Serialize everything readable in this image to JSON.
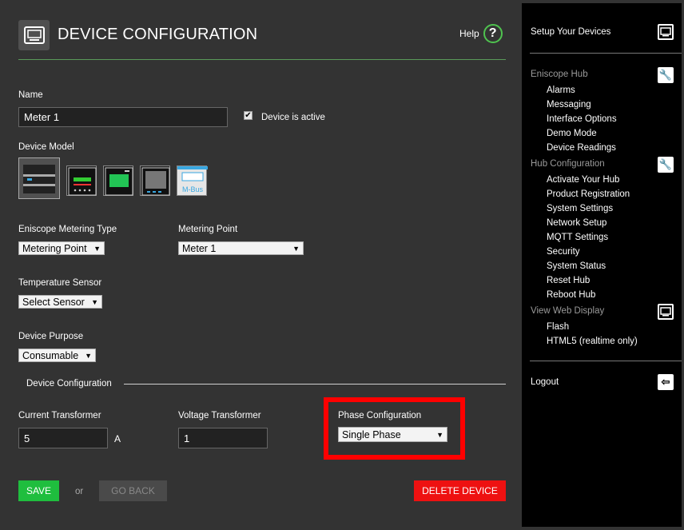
{
  "header": {
    "title": "DEVICE CONFIGURATION",
    "help_label": "Help",
    "help_icon": "question-circle-icon",
    "device_icon": "monitor-icon"
  },
  "form": {
    "name_label": "Name",
    "name_value": "Meter 1",
    "active_label": "Device is active",
    "active_checked": true,
    "model_label": "Device Model",
    "models": [
      {
        "icon": "din-rail-meter-icon",
        "selected": true
      },
      {
        "icon": "meter-display-red-icon",
        "selected": false
      },
      {
        "icon": "meter-display-green-icon",
        "selected": false
      },
      {
        "icon": "meter-display-grey-icon",
        "selected": false
      },
      {
        "icon": "mbus-meter-icon",
        "label": "M-Bus",
        "selected": false
      }
    ],
    "metering_type_label": "Eniscope Metering Type",
    "metering_type_value": "Metering Point",
    "metering_point_label": "Metering Point",
    "metering_point_value": "Meter 1",
    "temp_sensor_label": "Temperature Sensor",
    "temp_sensor_value": "Select Sensor",
    "purpose_label": "Device Purpose",
    "purpose_value": "Consumable",
    "section_title": "Device Configuration",
    "ct_label": "Current Transformer",
    "ct_value": "5",
    "ct_unit": "A",
    "vt_label": "Voltage Transformer",
    "vt_value": "1",
    "phase_label": "Phase Configuration",
    "phase_value": "Single Phase"
  },
  "actions": {
    "save": "SAVE",
    "or": "or",
    "go_back": "GO BACK",
    "delete": "DELETE DEVICE"
  },
  "sidebar": {
    "setup": "Setup Your Devices",
    "hub_head": "Eniscope Hub",
    "hub_items": [
      "Alarms",
      "Messaging",
      "Interface Options",
      "Demo Mode",
      "Device Readings"
    ],
    "config_head": "Hub Configuration",
    "config_items": [
      "Activate Your Hub",
      "Product Registration",
      "System Settings",
      "Network Setup",
      "MQTT Settings",
      "Security",
      "System Status",
      "Reset Hub",
      "Reboot Hub"
    ],
    "display_head": "View Web Display",
    "display_items": [
      "Flash",
      "HTML5 (realtime only)"
    ],
    "logout": "Logout"
  },
  "colors": {
    "accent_green": "#1fbe3e",
    "delete_red": "#ee1111",
    "highlight_red": "#ff0000"
  }
}
